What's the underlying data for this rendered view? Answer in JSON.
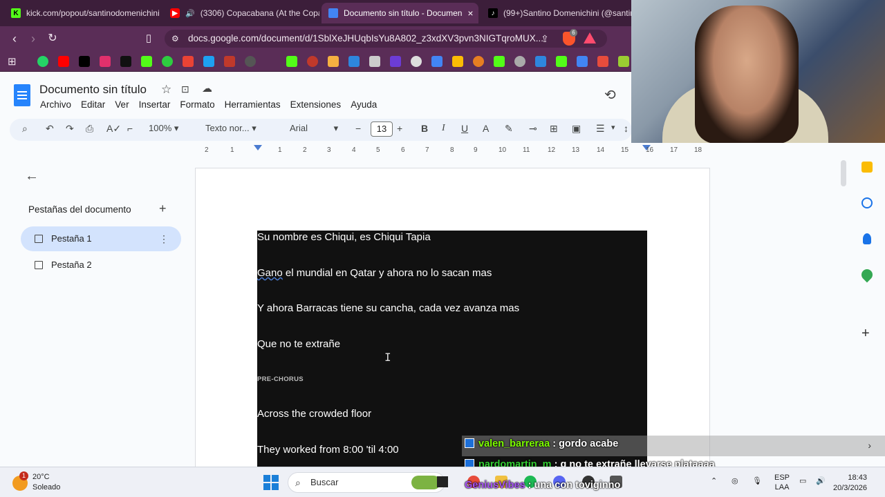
{
  "browser": {
    "tabs": [
      {
        "title": "kick.com/popout/santinodomenichini",
        "active": false
      },
      {
        "title": "(3306) Copacabana (At the Copa)",
        "active": false
      },
      {
        "title": "Documento sin título - Documen",
        "active": true
      },
      {
        "title": "(99+)Santino Domenichini (@santinc",
        "active": false
      }
    ],
    "url": "docs.google.com/document/d/1SblXeJHUqbIsYu8A802_z3xdXV3pvn3NIGTqroMUX...",
    "extension_badge": "6"
  },
  "docs": {
    "title": "Documento sin título",
    "menu": [
      "Archivo",
      "Editar",
      "Ver",
      "Insertar",
      "Formato",
      "Herramientas",
      "Extensiones",
      "Ayuda"
    ],
    "toolbar": {
      "zoom": "100%",
      "style": "Texto nor...",
      "font": "Arial",
      "font_size": "13"
    },
    "ruler": [
      "2",
      "1",
      "1",
      "2",
      "3",
      "4",
      "5",
      "6",
      "7",
      "8",
      "9",
      "10",
      "11",
      "12",
      "13",
      "14",
      "15",
      "16",
      "17",
      "18"
    ],
    "sidepanel": {
      "heading": "Pestañas del documento",
      "tabs": [
        "Pestaña 1",
        "Pestaña 2"
      ]
    },
    "content": [
      "Su nombre es Chiqui, es Chiqui Tapia",
      "Gano el mundial en Qatar y ahora no lo sacan mas",
      "Y ahora Barracas tiene su cancha, cada vez avanza mas",
      "Que no te extrañe",
      "PRE-CHORUS",
      "Across the crowded floor",
      "They worked from 8:00 'til 4:00"
    ]
  },
  "chat": [
    {
      "user": "valen_barreraa",
      "text": " : gordo acabe",
      "user_color": "#7cfc00"
    },
    {
      "user": "nardomartin_m",
      "text": " : q no te extrañe llevarse plataaaa",
      "user_color": "#32cd32"
    },
    {
      "user": "GeniusVibes",
      "text": " : una con toviginno",
      "user_color": "#a855f7"
    }
  ],
  "taskbar": {
    "weather_temp": "20°C",
    "weather_desc": "Soleado",
    "weather_badge": "1",
    "search_placeholder": "Buscar",
    "lang_1": "ESP",
    "lang_2": "LAA",
    "time": "18:43",
    "date": "20/3/2026"
  }
}
